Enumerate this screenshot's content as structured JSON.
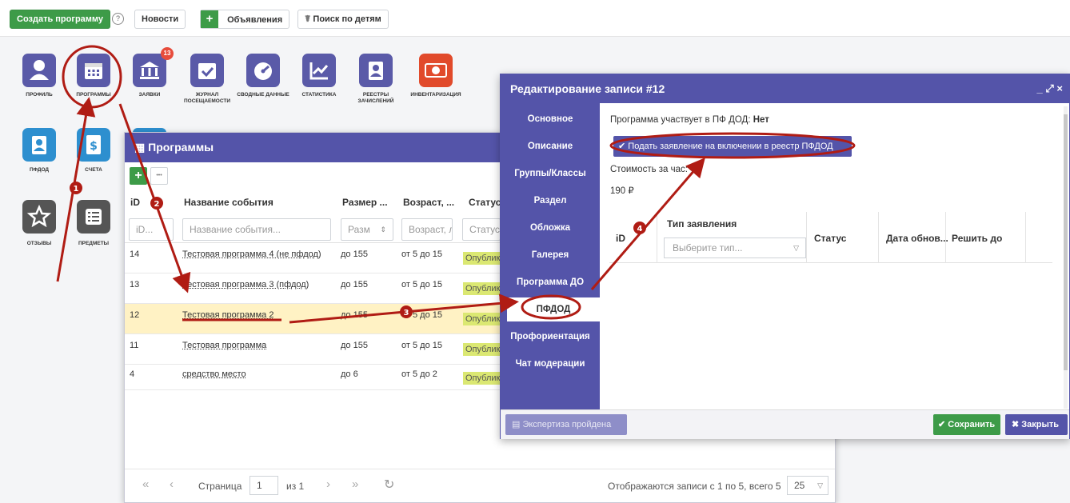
{
  "toolbar": {
    "create_program": "Создать программу",
    "help": "?",
    "news": "Новости",
    "plus": "+",
    "ads": "Объявления",
    "child_search": "Поиск по детям"
  },
  "dashboard": {
    "profile": "Профиль",
    "programs": "Программы",
    "requests": "Заявки",
    "requests_badge": "13",
    "attendance": "Журнал посещаемости",
    "summary": "Сводные данные",
    "statistics": "Статистика",
    "registries": "Реестры зачислений",
    "inventory": "Инвентаризация",
    "pfdod": "ПФДОД",
    "accounts": "Счета",
    "reviews": "Отзывы",
    "subjects": "Предметы"
  },
  "programs_window": {
    "title": "Программы",
    "add": "+",
    "more": "•••",
    "columns": {
      "id": "iD",
      "name": "Название события",
      "size": "Размер ...",
      "age": "Возраст, ...",
      "status": "Статус"
    },
    "filters": {
      "id": "iD...",
      "name": "Название события...",
      "size": "Разм",
      "age": "Возраст, л",
      "status": "Статус"
    },
    "rows": [
      {
        "id": "14",
        "name": "Тестовая программа 4 (не пфдод)",
        "size": "до 155",
        "age": "от 5 до 15",
        "status": "Опубликовано"
      },
      {
        "id": "13",
        "name": "Тестовая программа 3 (пфдод)",
        "size": "до 155",
        "age": "от 5 до 15",
        "status": "Опубликовано"
      },
      {
        "id": "12",
        "name": "Тестовая программа 2",
        "size": "до 155",
        "age": "от 5 до 15",
        "status": "Опубликовано"
      },
      {
        "id": "11",
        "name": "Тестовая программа",
        "size": "до 155",
        "age": "от 5 до 15",
        "status": "Опубликовано"
      },
      {
        "id": "4",
        "name": "средство место",
        "size": "до 6",
        "age": "от 5 до 2",
        "status": "Опубликовано"
      }
    ],
    "pager": {
      "first": "«",
      "prev": "‹",
      "page_label": "Страница",
      "page": "1",
      "of": "из 1",
      "next": "›",
      "last": "»",
      "refresh": "↻",
      "summary": "Отображаются записи с 1 по 5, всего 5",
      "per_page": "25"
    }
  },
  "edit_window": {
    "title": "Редактирование записи #12",
    "controls": "_ ⤢ ×",
    "sidebar": [
      "Основное",
      "Описание",
      "Группы/Классы",
      "Раздел",
      "Обложка",
      "Галерея",
      "Программа ДО",
      "ПФДОД",
      "Профориентация",
      "Чат модерации"
    ],
    "participates_label": "Программа участвует в ПФ ДОД:",
    "participates_value": "Нет",
    "apply_button": "Подать заявление на включении в реестр ПФДОД",
    "cost_label": "Стоимость за час:",
    "cost_value": "190 ₽",
    "table": {
      "id": "iD",
      "type": "Тип заявления",
      "type_placeholder": "Выберите тип...",
      "status": "Статус",
      "date": "Дата обнов...",
      "deadline": "Решить до"
    },
    "expertise_button": "Экспертиза пройдена",
    "save_button": "Сохранить",
    "close_button": "Закрыть"
  },
  "annotations": [
    "1",
    "2",
    "3",
    "4"
  ],
  "colors": {
    "accent": "#5454a9",
    "green": "#3d9b48",
    "annotation": "#b01c14",
    "selected_row": "#fff2c4"
  }
}
